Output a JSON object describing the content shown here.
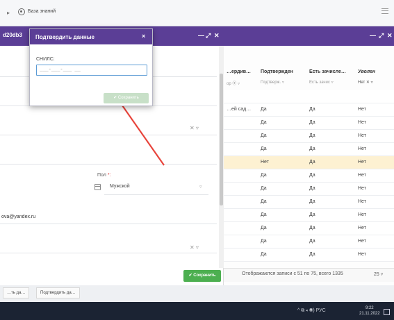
{
  "topbar": {
    "knowledge_base": "База знаний"
  },
  "main_window": {
    "title_fragment": "d20db3",
    "controls": {
      "minimize": "—",
      "maximize": "⤢",
      "close": "✕"
    }
  },
  "form": {
    "gender_label": "Пол ",
    "gender_required": "*:",
    "gender_value": "Мужской",
    "email_fragment": "ova@yandex.ru",
    "select_clear": "✕ ▿",
    "save_label": "✔ Сохранить"
  },
  "table": {
    "headers": [
      "…ердив…",
      "Подтвержден",
      "Есть зачисле…",
      "Уволен"
    ],
    "filters": [
      "ор ⦿ ▿",
      "Подтверж. ▿",
      "Есть зачис ▿",
      "Нет  ✕ ▿"
    ],
    "rows": [
      [
        "",
        "",
        "",
        ""
      ],
      [
        "…ей сад…",
        "Да",
        "Да",
        "Нет"
      ],
      [
        "",
        "Да",
        "Да",
        "Нет"
      ],
      [
        "",
        "Да",
        "Да",
        "Нет"
      ],
      [
        "",
        "Да",
        "Да",
        "Нет"
      ],
      [
        "",
        "Нет",
        "Да",
        "Нет"
      ],
      [
        "",
        "Да",
        "Да",
        "Нет"
      ],
      [
        "",
        "Да",
        "Да",
        "Нет"
      ],
      [
        "",
        "Да",
        "Да",
        "Нет"
      ],
      [
        "",
        "Да",
        "Да",
        "Нет"
      ],
      [
        "",
        "Да",
        "Да",
        "Нет"
      ],
      [
        "",
        "Да",
        "Да",
        "Нет"
      ],
      [
        "",
        "Да",
        "Да",
        "Нет"
      ]
    ],
    "highlight_row": 5,
    "footer_text": "Отображаются записи с 51 по 75, всего 1335",
    "page_size": "25 ▿"
  },
  "tabs": [
    "…ть да…",
    "Подтвердить да…"
  ],
  "taskbar": {
    "tray": "^  ⧉  ◂  ◉)  РУС",
    "time": "9:22",
    "date": "21.11.2022"
  },
  "dialog": {
    "title": "Подтвердить данные",
    "close": "×",
    "field_label": "СНИЛС:",
    "field_placeholder": "___-___-___ __",
    "save_label": "✔ Сохранить"
  },
  "colors": {
    "header": "#5b3e96",
    "accent_green": "#4caf50",
    "annotation_arrow": "#e8453c",
    "highlight_row": "#fdf1d2"
  }
}
